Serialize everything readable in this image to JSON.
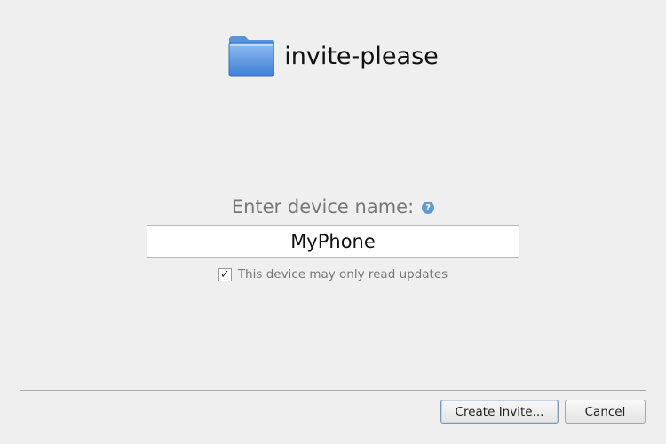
{
  "header": {
    "icon": "folder-icon",
    "title": "invite-please"
  },
  "form": {
    "prompt_label": "Enter device name:",
    "help_icon": "help-icon",
    "help_glyph": "?",
    "device_name_value": "MyPhone",
    "read_only_checked": true,
    "read_only_check_glyph": "✓",
    "read_only_label": "This device may only read updates"
  },
  "buttons": {
    "create_label": "Create Invite...",
    "cancel_label": "Cancel"
  },
  "colors": {
    "background": "#efefef",
    "folder_blue": "#4f8ee0",
    "help_blue": "#5e9ad6"
  }
}
